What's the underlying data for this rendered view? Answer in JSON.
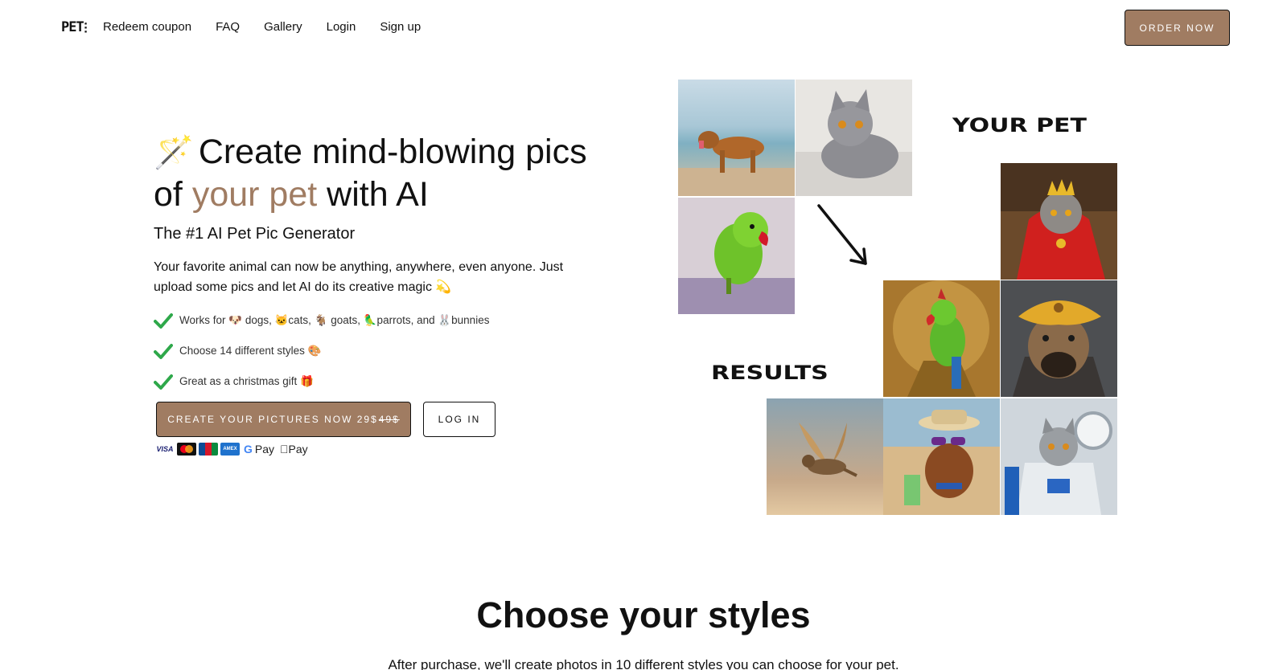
{
  "nav": {
    "logo": "PET",
    "logo_sub": "",
    "links": [
      "Redeem coupon",
      "FAQ",
      "Gallery",
      "Login",
      "Sign up"
    ],
    "order_button": "ORDER NOW"
  },
  "hero": {
    "title_icon": "🪄",
    "title_part1": "Create mind-blowing pics",
    "title_part2_prefix": "of ",
    "title_highlight": "your pet",
    "title_part2_suffix": " with AI",
    "subtitle": "The #1 AI Pet Pic Generator",
    "description": "Your favorite animal can now be anything, anywhere, even anyone. Just upload some pics and let AI do its creative magic 💫",
    "features": [
      "Works for 🐶 dogs, 🐱cats, 🐐 goats, 🦜parrots, and 🐰bunnies",
      "Choose 14 different styles 🎨",
      "Great as a christmas gift 🎁"
    ],
    "cta_label": "CREATE YOUR PICTURES NOW 29$",
    "cta_old_price": "49$",
    "login_label": "LOG IN",
    "payment_methods": [
      "VISA",
      "mastercard",
      "JCB",
      "AMEX",
      "G Pay",
      "Pay"
    ]
  },
  "collage": {
    "your_pet_label": "YOUR PET",
    "results_label": "RESULTS",
    "inputs": [
      "dog-beach-photo",
      "cat-carpet-photo",
      "parrot-photo"
    ],
    "results": [
      "king-cat-art",
      "parrot-golden-art",
      "dog-beret-art",
      "flying-dog-art",
      "dog-sunglasses-beach-art",
      "cat-astronaut-art"
    ]
  },
  "styles_section": {
    "title": "Choose your styles",
    "subtitle": "After purchase, we'll create photos in 10 different styles you can choose for your pet."
  },
  "colors": {
    "brand": "#a07c62",
    "text": "#111111",
    "check": "#2ea84a"
  }
}
